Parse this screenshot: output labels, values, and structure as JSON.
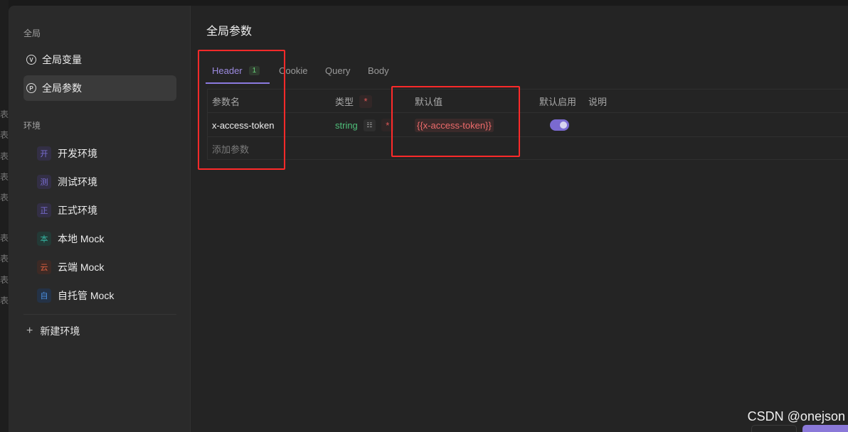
{
  "background_app": {
    "table_glyph": "表"
  },
  "sidebar": {
    "global_label": "全局",
    "global_items": [
      {
        "icon": "V",
        "label": "全局变量",
        "active": false
      },
      {
        "icon": "P",
        "label": "全局参数",
        "active": true
      }
    ],
    "env_label": "环境",
    "environments": [
      {
        "badge": "开",
        "label": "开发环境",
        "badge_color": "#7c6fd8",
        "badge_bg": "#332f45"
      },
      {
        "badge": "测",
        "label": "测试环境",
        "badge_color": "#7c6fd8",
        "badge_bg": "#332f45"
      },
      {
        "badge": "正",
        "label": "正式环境",
        "badge_color": "#7c6fd8",
        "badge_bg": "#332f45"
      },
      {
        "badge": "本",
        "label": "本地 Mock",
        "badge_color": "#36b3a0",
        "badge_bg": "#233a36"
      },
      {
        "badge": "云",
        "label": "云端 Mock",
        "badge_color": "#e0603f",
        "badge_bg": "#3d2a25"
      },
      {
        "badge": "自",
        "label": "自托管 Mock",
        "badge_color": "#4a8fe0",
        "badge_bg": "#243246"
      }
    ],
    "new_env_label": "新建环境"
  },
  "main": {
    "title": "全局参数",
    "tabs": [
      {
        "label": "Header",
        "count": "1",
        "active": true
      },
      {
        "label": "Cookie",
        "active": false
      },
      {
        "label": "Query",
        "active": false
      },
      {
        "label": "Body",
        "active": false
      }
    ],
    "table": {
      "headers": {
        "name": "参数名",
        "type": "类型",
        "required_mark": "*",
        "default": "默认值",
        "enabled": "默认启用",
        "desc": "说明"
      },
      "rows": [
        {
          "name": "x-access-token",
          "type": "string",
          "required_mark": "*",
          "default": "{{x-access-token}}",
          "enabled": true,
          "desc": ""
        }
      ],
      "add_placeholder": "添加参数"
    }
  },
  "watermark": "CSDN @onejson",
  "colors": {
    "accent": "#8b7ae0",
    "annotation_red": "#ff2a2a",
    "type_green": "#4fbf7a"
  },
  "icons": {
    "global_variable": "circle-v-icon",
    "global_param": "circle-p-icon",
    "type_settings": "settings-icon",
    "remove_row": "minus-circle-icon",
    "add": "plus-icon"
  }
}
